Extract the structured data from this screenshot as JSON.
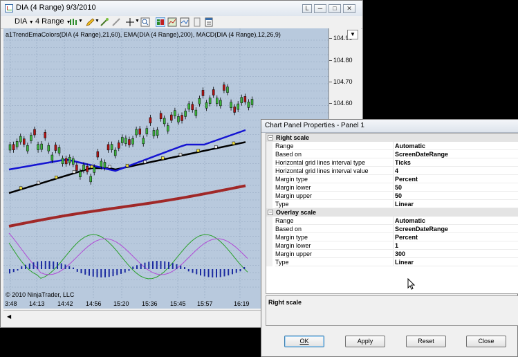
{
  "window": {
    "title": "DIA (4 Range)  9/3/2010",
    "btn_l": "L"
  },
  "toolbar": {
    "instrument": "DIA",
    "period": "4 Range"
  },
  "chart": {
    "indicator_label": "a1TrendEmaColors(DIA (4 Range),21,60), EMA(DIA (4 Range),200), MACD(DIA (4 Range),12,26,9)",
    "copyright": "© 2010 NinjaTrader, LLC",
    "price_labels": [
      "104.90",
      "104.80",
      "104.70",
      "104.60"
    ],
    "time_labels": [
      "3:48",
      "14:13",
      "14:42",
      "14:56",
      "15:20",
      "15:36",
      "15:45",
      "15:57",
      "16:19"
    ],
    "colors": {
      "background": "#b8c9dd",
      "ema_blue": "#1414d2",
      "ema_black": "#000000",
      "ema200": "#a02828",
      "macd_green": "#2aa02a",
      "macd_purple": "#b04ad6",
      "histogram": "#1a2aa0",
      "candle_up": "#3cb43c",
      "candle_down": "#b41414"
    }
  },
  "dialog": {
    "title": "Chart Panel Properties - Panel 1",
    "sections": [
      {
        "label": "Right scale",
        "rows": [
          {
            "name": "Range",
            "value": "Automatic"
          },
          {
            "name": "Based on",
            "value": "ScreenDateRange"
          },
          {
            "name": "Horizontal grid lines interval type",
            "value": "Ticks"
          },
          {
            "name": "Horizontal grid lines interval value",
            "value": "4"
          },
          {
            "name": "Margin type",
            "value": "Percent"
          },
          {
            "name": "Margin lower",
            "value": "50"
          },
          {
            "name": "Margin upper",
            "value": "50"
          },
          {
            "name": "Type",
            "value": "Linear"
          }
        ]
      },
      {
        "label": "Overlay scale",
        "rows": [
          {
            "name": "Range",
            "value": "Automatic"
          },
          {
            "name": "Based on",
            "value": "ScreenDateRange"
          },
          {
            "name": "Margin type",
            "value": "Percent"
          },
          {
            "name": "Margin lower",
            "value": "1"
          },
          {
            "name": "Margin upper",
            "value": "300"
          },
          {
            "name": "Type",
            "value": "Linear"
          }
        ]
      }
    ],
    "description_title": "Right scale",
    "buttons": {
      "ok": "OK",
      "apply": "Apply",
      "reset": "Reset",
      "close": "Close"
    }
  }
}
